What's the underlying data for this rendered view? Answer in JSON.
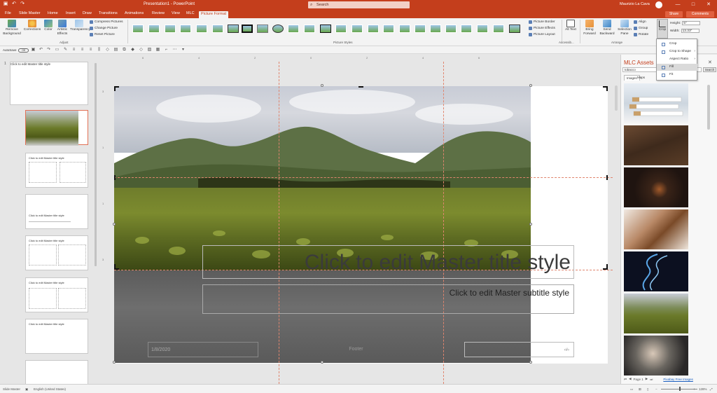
{
  "titlebar": {
    "title": "Presentation1 - PowerPoint",
    "search_placeholder": "Search",
    "user": "Maurizio La Cava",
    "controls": [
      "—",
      "□",
      "✕"
    ]
  },
  "tabs": {
    "items": [
      "File",
      "Slide Master",
      "Home",
      "Insert",
      "Draw",
      "Transitions",
      "Animations",
      "Review",
      "View",
      "MLC",
      "Picture Format"
    ],
    "active": "Picture Format",
    "share": "Share",
    "comments": "Comments"
  },
  "ribbon": {
    "remove_background": "Remove Background",
    "corrections": "Corrections",
    "color": "Color",
    "artistic_effects": "Artistic Effects",
    "transparency": "Transparency",
    "compress": "Compress Pictures",
    "change": "Change Picture",
    "reset": "Reset Picture",
    "adjust_label": "Adjust",
    "styles_label": "Picture Styles",
    "picture_border": "Picture Border",
    "picture_effects": "Picture Effects",
    "picture_layout": "Picture Layout",
    "alt_text": "Alt Text",
    "accessibility_label": "Accessib...",
    "bring_forward": "Bring Forward",
    "send_backward": "Send Backward",
    "selection_pane": "Selection Pane",
    "align": "Align",
    "group": "Group",
    "rotate": "Rotate",
    "arrange_label": "Arrange",
    "crop": "Crop",
    "height_label": "Height:",
    "height_value": "5\"",
    "width_label": "Width:",
    "width_value": "13.33\""
  },
  "qat": {
    "autosave_label": "AutoSave",
    "autosave_state": "Off"
  },
  "crop_menu": {
    "items": [
      "Crop",
      "Crop to Shape",
      "Aspect Ratio",
      "Fill",
      "Fit"
    ],
    "highlighted": "Fill"
  },
  "thumbs": {
    "master_number": "1",
    "master_title": "Click to edit Master title style",
    "layout_titles": [
      "Click to edit Master title style",
      "Click to edit Master title style",
      "Click to edit Master title style",
      "Click to edit Master title style",
      "Click to edit Master title style"
    ]
  },
  "slide": {
    "title_placeholder": "Click to edit Master title style",
    "subtitle_placeholder": "Click to edit Master subtitle style",
    "date": "1/8/2020",
    "footer": "Footer",
    "slide_number": "‹#›"
  },
  "pane": {
    "title": "MLC Assets",
    "search_value": "tobacco",
    "search_button": "Search",
    "tab_images": "Images",
    "tab_maps": "Maps",
    "page_label": "Page 1",
    "free_images_link": "Pixabay Free Images"
  },
  "status": {
    "view": "Slide Master",
    "language": "English (United States)",
    "zoom": "128%"
  },
  "colors": {
    "accent": "#c43e1c",
    "selection": "#e17055"
  }
}
